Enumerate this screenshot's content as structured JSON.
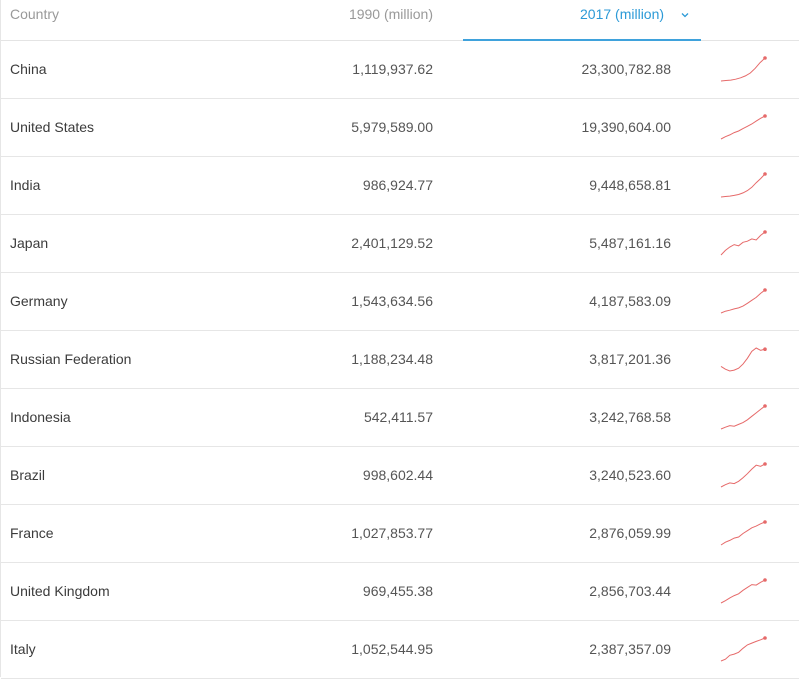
{
  "table": {
    "headers": {
      "country": "Country",
      "y1990": "1990 (million)",
      "y2017": "2017 (million)"
    },
    "sort_icon": "chevron-down-icon",
    "accent_color": "#2c9ad7",
    "spark_color": "#e66a6a",
    "rows": [
      {
        "country": "China",
        "y1990": "1,119,937.62",
        "y2017": "23,300,782.88",
        "trend": [
          0,
          2,
          4,
          8,
          14,
          22,
          35,
          55,
          80,
          100
        ]
      },
      {
        "country": "United States",
        "y1990": "5,979,589.00",
        "y2017": "19,390,604.00",
        "trend": [
          0,
          10,
          18,
          28,
          35,
          45,
          55,
          65,
          78,
          90,
          100
        ]
      },
      {
        "country": "India",
        "y1990": "986,924.77",
        "y2017": "9,448,658.81",
        "trend": [
          0,
          2,
          4,
          7,
          11,
          18,
          28,
          42,
          62,
          80,
          100
        ]
      },
      {
        "country": "Japan",
        "y1990": "2,401,129.52",
        "y2017": "5,487,161.16",
        "trend": [
          0,
          20,
          35,
          45,
          40,
          55,
          60,
          70,
          65,
          85,
          100
        ]
      },
      {
        "country": "Germany",
        "y1990": "1,543,634.56",
        "y2017": "4,187,583.09",
        "trend": [
          0,
          8,
          12,
          18,
          22,
          30,
          42,
          55,
          68,
          85,
          100
        ]
      },
      {
        "country": "Russian Federation",
        "y1990": "1,188,234.48",
        "y2017": "3,817,201.36",
        "trend": [
          20,
          8,
          0,
          4,
          12,
          30,
          55,
          85,
          100,
          90,
          95
        ]
      },
      {
        "country": "Indonesia",
        "y1990": "542,411.57",
        "y2017": "3,242,768.58",
        "trend": [
          0,
          8,
          15,
          12,
          20,
          28,
          40,
          55,
          70,
          85,
          100
        ]
      },
      {
        "country": "Brazil",
        "y1990": "998,602.44",
        "y2017": "3,240,523.60",
        "trend": [
          0,
          10,
          18,
          15,
          25,
          40,
          58,
          78,
          95,
          90,
          100
        ]
      },
      {
        "country": "France",
        "y1990": "1,027,853.77",
        "y2017": "2,876,059.99",
        "trend": [
          0,
          12,
          20,
          30,
          35,
          50,
          62,
          75,
          82,
          92,
          100
        ]
      },
      {
        "country": "United Kingdom",
        "y1990": "969,455.38",
        "y2017": "2,856,703.44",
        "trend": [
          0,
          10,
          22,
          32,
          40,
          55,
          68,
          80,
          78,
          90,
          100
        ]
      },
      {
        "country": "Italy",
        "y1990": "1,052,544.95",
        "y2017": "2,387,357.09",
        "trend": [
          0,
          8,
          25,
          30,
          38,
          55,
          70,
          78,
          85,
          92,
          100
        ]
      }
    ]
  }
}
